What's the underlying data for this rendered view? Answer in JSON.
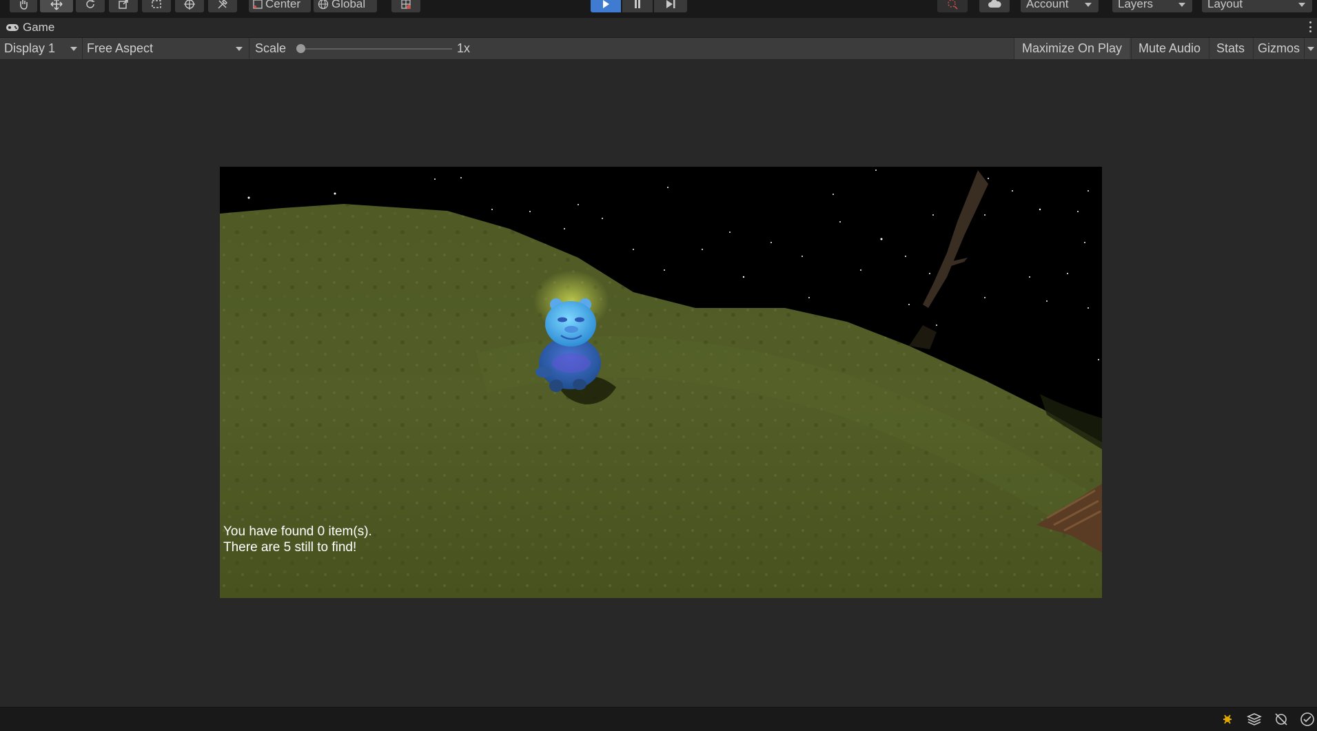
{
  "toolbar": {
    "tools": [
      {
        "icon": "hand-tool-icon"
      },
      {
        "icon": "move-tool-icon"
      },
      {
        "icon": "rotate-tool-icon"
      },
      {
        "icon": "scale-tool-icon"
      },
      {
        "icon": "rect-tool-icon"
      },
      {
        "icon": "transform-tool-icon"
      },
      {
        "icon": "custom-tool-icon"
      }
    ],
    "pivot_mode": "Center",
    "pivot_rotation": "Global",
    "account_label": "Account",
    "layers_label": "Layers",
    "layout_label": "Layout",
    "accent_color": "#3e7bd1"
  },
  "tab": {
    "title": "Game"
  },
  "game_controls": {
    "display": "Display 1",
    "aspect": "Free Aspect",
    "scale_label": "Scale",
    "scale_value": "1x",
    "scale_level": 0.0,
    "maximize_on_play": "Maximize On Play",
    "mute_audio": "Mute Audio",
    "stats": "Stats",
    "gizmos": "Gizmos"
  },
  "game_view": {
    "hud_line1": "You have found 0 item(s).",
    "hud_line2": "There are 5 still to find!"
  },
  "status_bar": {
    "icons": [
      "debug-icon",
      "layers-stack-icon",
      "network-off-icon",
      "check-icon"
    ]
  }
}
